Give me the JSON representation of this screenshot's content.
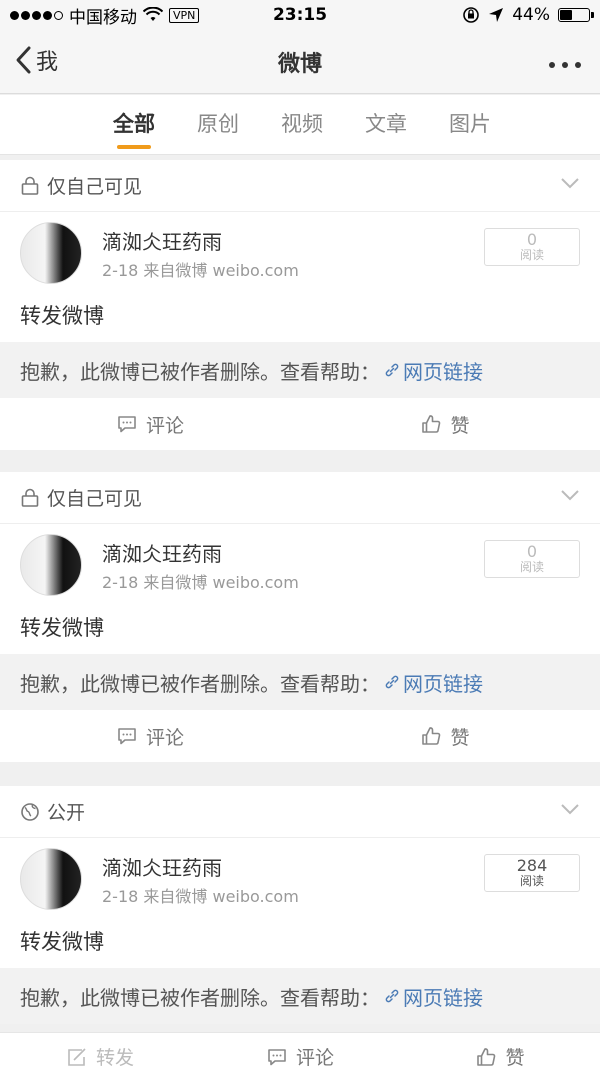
{
  "status": {
    "carrier": "中国移动",
    "vpn": "VPN",
    "time": "23:15",
    "battery_pct": "44%",
    "battery_level": 0.44
  },
  "nav": {
    "back_label": "我",
    "title": "微博"
  },
  "tabs": [
    {
      "label": "全部",
      "active": true
    },
    {
      "label": "原创",
      "active": false
    },
    {
      "label": "视频",
      "active": false
    },
    {
      "label": "文章",
      "active": false
    },
    {
      "label": "图片",
      "active": false
    }
  ],
  "cards": [
    {
      "visibility": "仅自己可见",
      "visibility_icon": "lock-icon",
      "user_name": "滴洳仌玨药雨",
      "meta": "2-18  来自微博 weibo.com",
      "read_count": "0",
      "read_label": "阅读",
      "text": "转发微博",
      "deleted_notice": "抱歉，此微博已被作者删除。查看帮助：",
      "link_text": "网页链接",
      "comment_label": "评论",
      "like_label": "赞"
    },
    {
      "visibility": "仅自己可见",
      "visibility_icon": "lock-icon",
      "user_name": "滴洳仌玨药雨",
      "meta": "2-18  来自微博 weibo.com",
      "read_count": "0",
      "read_label": "阅读",
      "text": "转发微博",
      "deleted_notice": "抱歉，此微博已被作者删除。查看帮助：",
      "link_text": "网页链接",
      "comment_label": "评论",
      "like_label": "赞"
    },
    {
      "visibility": "公开",
      "visibility_icon": "globe-icon",
      "user_name": "滴洳仌玨药雨",
      "meta": "2-18  来自微博 weibo.com",
      "read_count": "284",
      "read_label": "阅读",
      "text": "转发微博",
      "deleted_notice": "抱歉，此微博已被作者删除。查看帮助：",
      "link_text": "网页链接",
      "repost_label": "转发",
      "comment_label": "评论",
      "like_label": "赞"
    }
  ],
  "colors": {
    "accent": "#f09b1b",
    "link": "#4b7bb5"
  }
}
